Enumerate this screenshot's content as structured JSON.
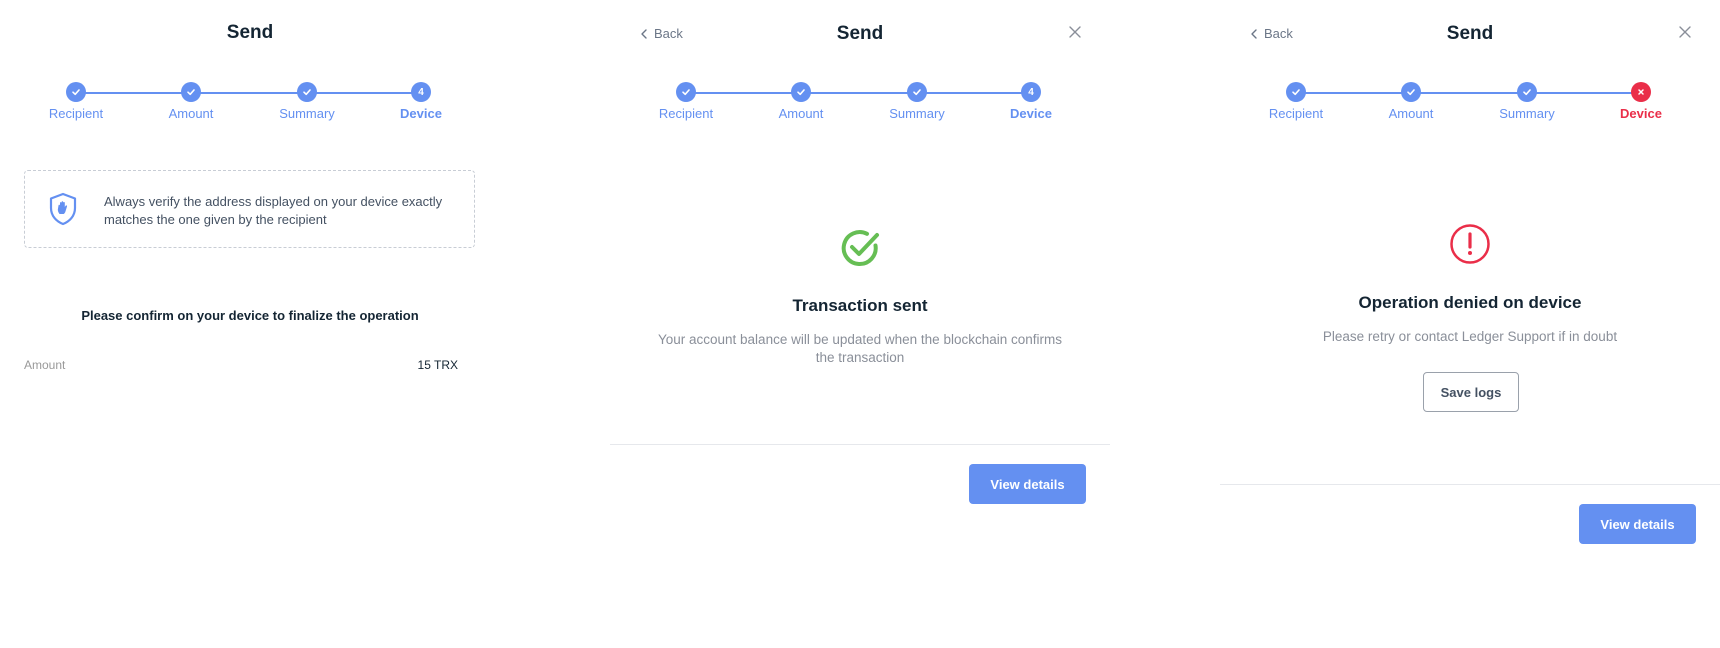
{
  "colors": {
    "accent": "#6490f1",
    "success": "#66be54",
    "error": "#ea2e49"
  },
  "steps": [
    "Recipient",
    "Amount",
    "Summary",
    "Device"
  ],
  "current_step_number": "4",
  "panel1": {
    "title": "Send",
    "warning_text": "Always verify the address displayed on your device exactly matches the one given by the recipient",
    "confirm_text": "Please confirm on your device to finalize the operation",
    "amount_label": "Amount",
    "amount_value": "15 TRX"
  },
  "panel2": {
    "back_label": "Back",
    "title": "Send",
    "status_title": "Transaction sent",
    "status_desc": "Your account balance will be updated when the blockchain confirms the transaction",
    "button_label": "View details"
  },
  "panel3": {
    "back_label": "Back",
    "title": "Send",
    "status_title": "Operation denied on device",
    "status_desc": "Please retry or contact Ledger Support if in doubt",
    "save_logs_label": "Save logs",
    "button_label": "View details"
  }
}
